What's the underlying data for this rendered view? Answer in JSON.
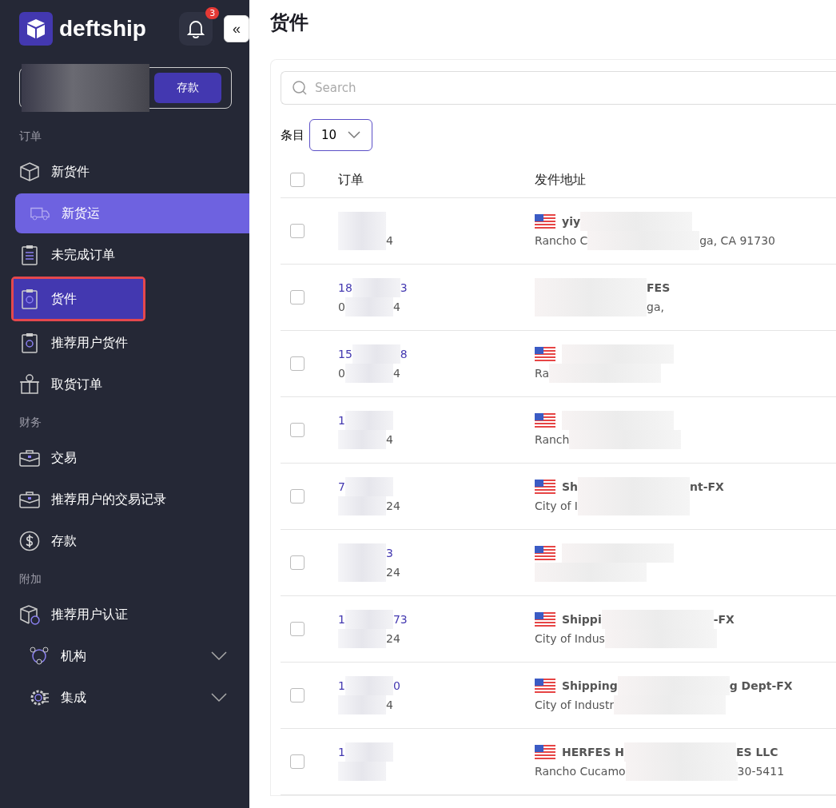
{
  "brand": {
    "name": "deftship"
  },
  "notifications": {
    "count": "3"
  },
  "collapse_button": {
    "label": "«"
  },
  "balance": {
    "redacted": true,
    "button": "存款"
  },
  "sidebar": {
    "sections": [
      {
        "heading": "订单",
        "items": [
          {
            "label": "新货件",
            "kind": "link",
            "selected": false,
            "annotated": false
          },
          {
            "label": "新货运",
            "kind": "action",
            "selected": false,
            "annotated": false
          },
          {
            "label": "未完成订单",
            "kind": "link",
            "selected": false,
            "annotated": false
          },
          {
            "label": "货件",
            "kind": "link",
            "selected": true,
            "annotated": true
          },
          {
            "label": "推荐用户货件",
            "kind": "link",
            "selected": false,
            "annotated": false
          },
          {
            "label": "取货订单",
            "kind": "link",
            "selected": false,
            "annotated": false
          }
        ]
      },
      {
        "heading": "财务",
        "items": [
          {
            "label": "交易",
            "kind": "link",
            "selected": false,
            "annotated": false
          },
          {
            "label": "推荐用户的交易记录",
            "kind": "link",
            "selected": false,
            "annotated": false
          },
          {
            "label": "存款",
            "kind": "link",
            "selected": false,
            "annotated": false
          }
        ]
      },
      {
        "heading": "附加",
        "items": [
          {
            "label": "推荐用户认证",
            "kind": "link",
            "selected": false,
            "annotated": false
          },
          {
            "label": "机构",
            "kind": "group",
            "expanded": false,
            "selected": false,
            "annotated": false
          },
          {
            "label": "集成",
            "kind": "group",
            "expanded": false,
            "selected": false,
            "annotated": false
          }
        ]
      }
    ]
  },
  "page": {
    "title": "货件"
  },
  "search": {
    "placeholder": "Search"
  },
  "page_size": {
    "label": "条目",
    "value": "10"
  },
  "table": {
    "columns": [
      "订单",
      "发件地址"
    ],
    "all_checked": false,
    "rows": [
      {
        "checked": false,
        "flag": true,
        "order": [
          {
            "kind": "redacted"
          }
        ],
        "date": [
          {
            "kind": "redacted"
          },
          {
            "kind": "text",
            "text": "4"
          }
        ],
        "name": [
          {
            "kind": "text",
            "text": "yiy"
          },
          {
            "kind": "redacted"
          }
        ],
        "address": [
          {
            "kind": "text",
            "text": "Rancho C"
          },
          {
            "kind": "redacted"
          },
          {
            "kind": "text",
            "text": "ga, CA 91730"
          }
        ]
      },
      {
        "checked": false,
        "flag": false,
        "order": [
          {
            "kind": "text",
            "text": "18"
          },
          {
            "kind": "redacted"
          },
          {
            "kind": "text",
            "text": "3"
          }
        ],
        "date": [
          {
            "kind": "text",
            "text": "0"
          },
          {
            "kind": "redacted"
          },
          {
            "kind": "text",
            "text": "4"
          }
        ],
        "name": [
          {
            "kind": "redacted"
          },
          {
            "kind": "text",
            "text": "FES"
          }
        ],
        "address": [
          {
            "kind": "redacted"
          },
          {
            "kind": "text",
            "text": "ga,"
          }
        ]
      },
      {
        "checked": false,
        "flag": true,
        "order": [
          {
            "kind": "text",
            "text": "15"
          },
          {
            "kind": "redacted"
          },
          {
            "kind": "text",
            "text": "8"
          }
        ],
        "date": [
          {
            "kind": "text",
            "text": "0"
          },
          {
            "kind": "redacted"
          },
          {
            "kind": "text",
            "text": "4"
          }
        ],
        "name": [
          {
            "kind": "redacted"
          }
        ],
        "address": [
          {
            "kind": "text",
            "text": "Ra"
          },
          {
            "kind": "redacted"
          }
        ]
      },
      {
        "checked": false,
        "flag": true,
        "order": [
          {
            "kind": "text",
            "text": "1"
          },
          {
            "kind": "redacted"
          }
        ],
        "date": [
          {
            "kind": "redacted"
          },
          {
            "kind": "text",
            "text": "4"
          }
        ],
        "name": [
          {
            "kind": "redacted"
          }
        ],
        "address": [
          {
            "kind": "text",
            "text": "Ranch"
          },
          {
            "kind": "redacted"
          }
        ]
      },
      {
        "checked": false,
        "flag": true,
        "order": [
          {
            "kind": "text",
            "text": "7"
          },
          {
            "kind": "redacted"
          }
        ],
        "date": [
          {
            "kind": "redacted"
          },
          {
            "kind": "text",
            "text": "24"
          }
        ],
        "name": [
          {
            "kind": "text",
            "text": "Sh"
          },
          {
            "kind": "redacted"
          },
          {
            "kind": "text",
            "text": "nt-FX"
          }
        ],
        "address": [
          {
            "kind": "text",
            "text": "City of I"
          },
          {
            "kind": "redacted"
          }
        ]
      },
      {
        "checked": false,
        "flag": true,
        "order": [
          {
            "kind": "redacted"
          },
          {
            "kind": "text",
            "text": "3"
          }
        ],
        "date": [
          {
            "kind": "redacted"
          },
          {
            "kind": "text",
            "text": "24"
          }
        ],
        "name": [
          {
            "kind": "redacted"
          }
        ],
        "address": [
          {
            "kind": "redacted"
          }
        ]
      },
      {
        "checked": false,
        "flag": true,
        "order": [
          {
            "kind": "text",
            "text": "1"
          },
          {
            "kind": "redacted"
          },
          {
            "kind": "text",
            "text": "73"
          }
        ],
        "date": [
          {
            "kind": "redacted"
          },
          {
            "kind": "text",
            "text": "24"
          }
        ],
        "name": [
          {
            "kind": "text",
            "text": "Shippi"
          },
          {
            "kind": "redacted"
          },
          {
            "kind": "text",
            "text": "-FX"
          }
        ],
        "address": [
          {
            "kind": "text",
            "text": "City of Indus"
          },
          {
            "kind": "redacted"
          }
        ]
      },
      {
        "checked": false,
        "flag": true,
        "order": [
          {
            "kind": "text",
            "text": "1"
          },
          {
            "kind": "redacted"
          },
          {
            "kind": "text",
            "text": "0"
          }
        ],
        "date": [
          {
            "kind": "redacted"
          },
          {
            "kind": "text",
            "text": "4"
          }
        ],
        "name": [
          {
            "kind": "text",
            "text": "Shipping"
          },
          {
            "kind": "redacted"
          },
          {
            "kind": "text",
            "text": "g Dept-FX"
          }
        ],
        "address": [
          {
            "kind": "text",
            "text": "City of Industr"
          },
          {
            "kind": "redacted"
          }
        ]
      },
      {
        "checked": false,
        "flag": true,
        "order": [
          {
            "kind": "text",
            "text": "1"
          },
          {
            "kind": "redacted"
          }
        ],
        "date": [
          {
            "kind": "redacted"
          }
        ],
        "name": [
          {
            "kind": "text",
            "text": "HERFES H"
          },
          {
            "kind": "redacted"
          },
          {
            "kind": "text",
            "text": "ES LLC"
          }
        ],
        "address": [
          {
            "kind": "text",
            "text": "Rancho Cucamo"
          },
          {
            "kind": "redacted"
          },
          {
            "kind": "text",
            "text": "30-5411"
          }
        ]
      }
    ]
  }
}
